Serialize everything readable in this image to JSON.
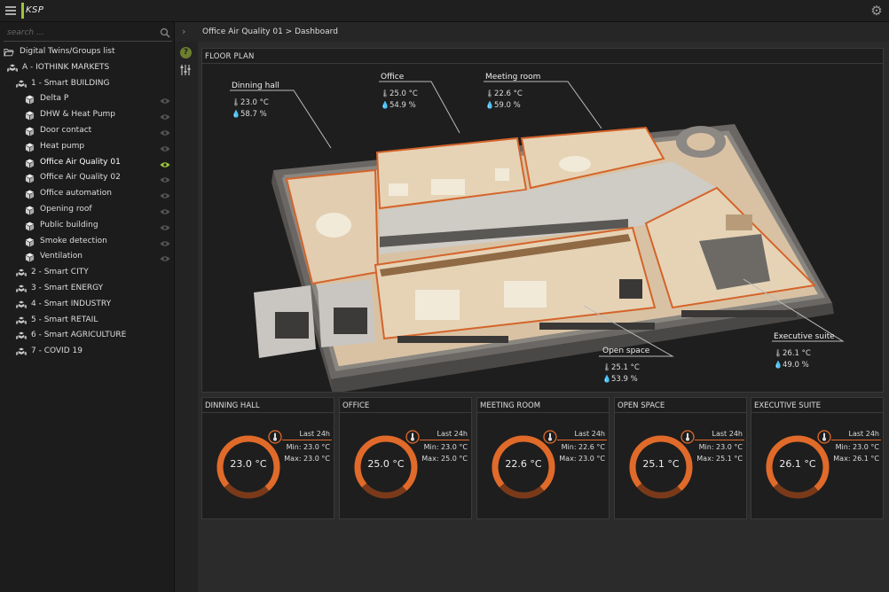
{
  "app": {
    "logo_text": "KSP"
  },
  "search": {
    "placeholder": "search ..."
  },
  "tree": {
    "root_label": "Digital Twins/Groups list",
    "items": [
      {
        "label": "A - IOTHINK MARKETS",
        "level": 0,
        "icon": "group-icon",
        "eye": false
      },
      {
        "label": "1 - Smart BUILDING",
        "level": 1,
        "icon": "group-icon",
        "eye": false
      },
      {
        "label": "Delta P",
        "level": 2,
        "icon": "cube-icon",
        "eye": true
      },
      {
        "label": "DHW & Heat Pump",
        "level": 2,
        "icon": "cube-icon",
        "eye": true
      },
      {
        "label": "Door contact",
        "level": 2,
        "icon": "cube-icon",
        "eye": true
      },
      {
        "label": "Heat pump",
        "level": 2,
        "icon": "cube-icon",
        "eye": true
      },
      {
        "label": "Office Air Quality 01",
        "level": 2,
        "icon": "cube-icon",
        "eye": true,
        "active": true
      },
      {
        "label": "Office Air Quality 02",
        "level": 2,
        "icon": "cube-icon",
        "eye": true
      },
      {
        "label": "Office automation",
        "level": 2,
        "icon": "cube-icon",
        "eye": true
      },
      {
        "label": "Opening roof",
        "level": 2,
        "icon": "cube-icon",
        "eye": true
      },
      {
        "label": "Public building",
        "level": 2,
        "icon": "cube-icon",
        "eye": true
      },
      {
        "label": "Smoke detection",
        "level": 2,
        "icon": "cube-icon",
        "eye": true
      },
      {
        "label": "Ventilation",
        "level": 2,
        "icon": "cube-icon",
        "eye": true
      },
      {
        "label": "2 - Smart CITY",
        "level": 1,
        "icon": "group-icon",
        "eye": false
      },
      {
        "label": "3 - Smart ENERGY",
        "level": 1,
        "icon": "group-icon",
        "eye": false
      },
      {
        "label": "4 - Smart INDUSTRY",
        "level": 1,
        "icon": "group-icon",
        "eye": false
      },
      {
        "label": "5 - Smart RETAIL",
        "level": 1,
        "icon": "group-icon",
        "eye": false
      },
      {
        "label": "6 - Smart AGRICULTURE",
        "level": 1,
        "icon": "group-icon",
        "eye": false
      },
      {
        "label": "7 - COVID 19",
        "level": 1,
        "icon": "group-icon",
        "eye": false
      }
    ]
  },
  "breadcrumb": "Office Air Quality 01 > Dashboard",
  "tools": {
    "help_glyph": "?"
  },
  "floor_plan": {
    "title": "FLOOR PLAN",
    "rooms": [
      {
        "name": "Dinning hall",
        "temp": "23.0 °C",
        "humidity": "58.7 %"
      },
      {
        "name": "Office",
        "temp": "25.0 °C",
        "humidity": "54.9 %"
      },
      {
        "name": "Meeting room",
        "temp": "22.6 °C",
        "humidity": "59.0 %"
      },
      {
        "name": "Open space",
        "temp": "25.1 °C",
        "humidity": "53.9 %"
      },
      {
        "name": "Executive suite",
        "temp": "26.1 °C",
        "humidity": "49.0 %"
      }
    ]
  },
  "cards": [
    {
      "title": "DINNING HALL",
      "value": "23.0 °C",
      "last": "Last 24h",
      "min": "Min: 23.0 °C",
      "max": "Max: 23.0 °C"
    },
    {
      "title": "OFFICE",
      "value": "25.0 °C",
      "last": "Last 24h",
      "min": "Min: 23.0 °C",
      "max": "Max: 25.0 °C"
    },
    {
      "title": "MEETING ROOM",
      "value": "22.6 °C",
      "last": "Last 24h",
      "min": "Min: 22.6 °C",
      "max": "Max: 23.0 °C"
    },
    {
      "title": "OPEN SPACE",
      "value": "25.1 °C",
      "last": "Last 24h",
      "min": "Min: 23.0 °C",
      "max": "Max: 25.1 °C"
    },
    {
      "title": "EXECUTIVE SUITE",
      "value": "26.1 °C",
      "last": "Last 24h",
      "min": "Min: 23.0 °C",
      "max": "Max: 26.1 °C"
    }
  ],
  "colors": {
    "accent_orange": "#e06a2a",
    "accent_green": "#9bc53d",
    "panel_bg": "#1e1e1e"
  }
}
